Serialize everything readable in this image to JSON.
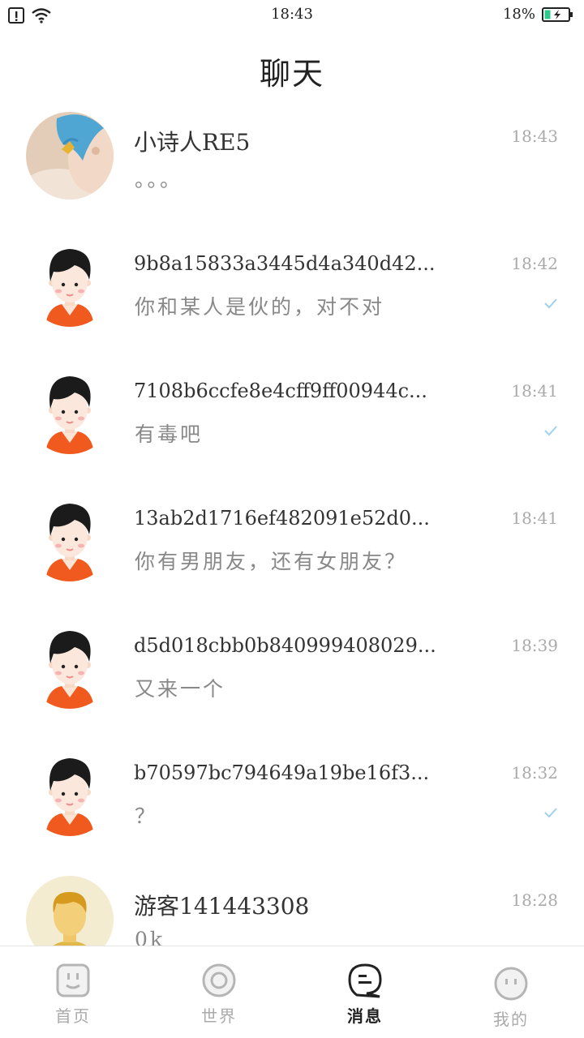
{
  "status_bar": {
    "time": "18:43",
    "battery": "18%"
  },
  "header": {
    "title": "聊天"
  },
  "chats": [
    {
      "name": "小诗人RE5",
      "preview": "。。。",
      "time": "18:43",
      "read": false
    },
    {
      "name": "9b8a15833a3445d4a340d42...",
      "preview": "你和某人是伙的，对不对",
      "time": "18:42",
      "read": true
    },
    {
      "name": "7108b6ccfe8e4cff9ff00944c...",
      "preview": "有毒吧",
      "time": "18:41",
      "read": true
    },
    {
      "name": "13ab2d1716ef482091e52d0...",
      "preview": "你有男朋友，还有女朋友？",
      "time": "18:41",
      "read": false
    },
    {
      "name": "d5d018cbb0b840999408029...",
      "preview": "又来一个",
      "time": "18:39",
      "read": false
    },
    {
      "name": "b70597bc794649a19be16f3...",
      "preview": "？",
      "time": "18:32",
      "read": true
    },
    {
      "name": "游客141443308",
      "preview": "0k",
      "time": "18:28",
      "read": false
    }
  ],
  "nav": [
    {
      "label": "首页",
      "icon": "home-face-icon"
    },
    {
      "label": "世界",
      "icon": "world-ring-icon"
    },
    {
      "label": "消息",
      "icon": "message-bubble-icon",
      "active": true
    },
    {
      "label": "我的",
      "icon": "profile-face-icon"
    }
  ],
  "colors": {
    "check": "#9fd2f0",
    "orange": "#f05a1e",
    "accent": "#2dc98a"
  }
}
